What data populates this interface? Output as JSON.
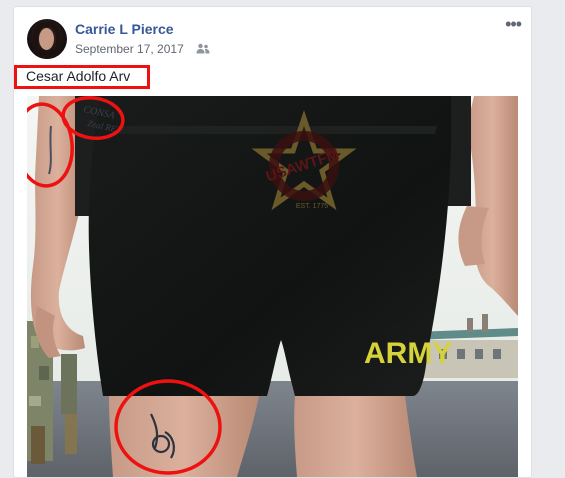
{
  "post": {
    "author_name": "Carrie L Pierce",
    "date": "September 17, 2017",
    "audience_icon": "friends-icon",
    "more_icon": "more-options-icon",
    "more_label": "•••",
    "text": "Cesar Adolfo Arv"
  },
  "photo": {
    "logo_text": "USAWTFM",
    "logo_subtext": "EST. 1775",
    "shorts_text": "ARMY",
    "tattoo_text_1": "CONSA",
    "tattoo_text_2": "Zeal RE"
  },
  "colors": {
    "accent": "#365899",
    "highlight_red": "#ee1111",
    "shorts_text": "#d6d23a"
  }
}
